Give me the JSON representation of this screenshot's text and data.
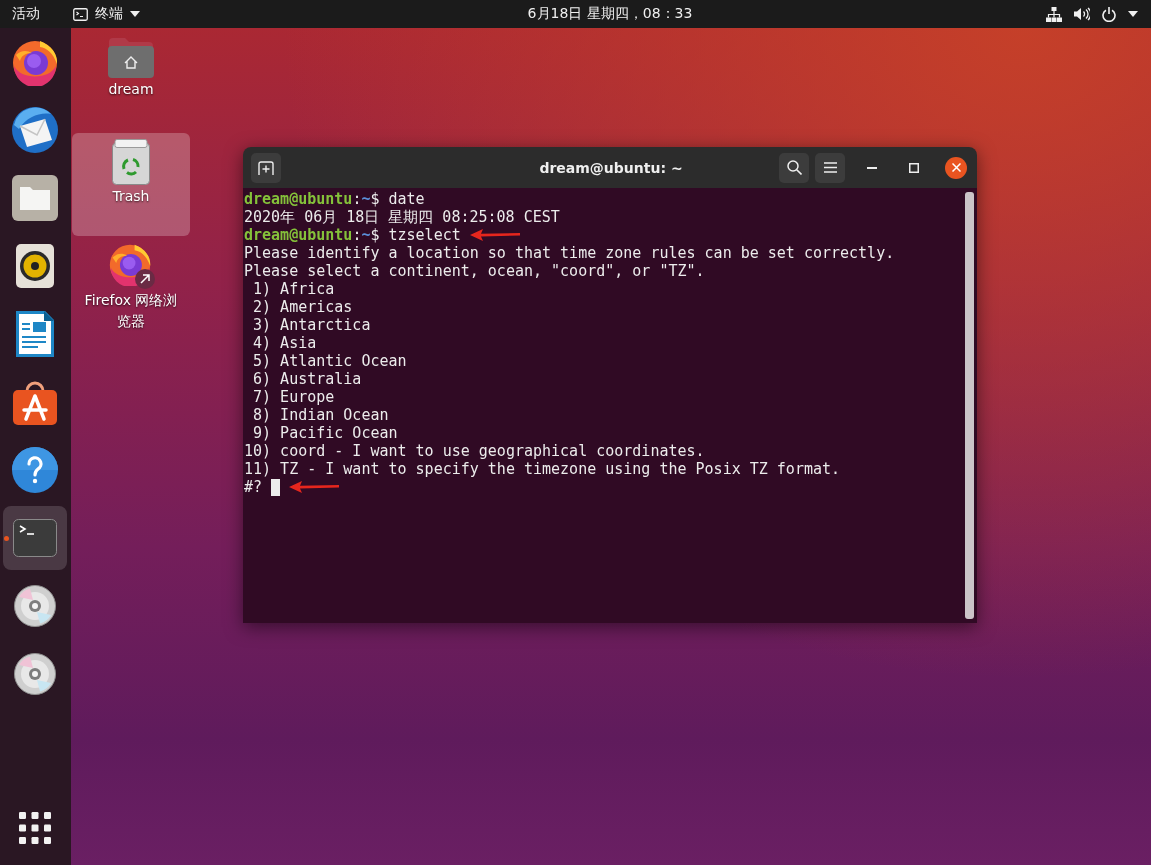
{
  "top_bar": {
    "activities": "活动",
    "app_menu": "终端",
    "clock": "6月18日 星期四，08：33"
  },
  "dock": {
    "items": [
      {
        "kind": "browser",
        "selected": false,
        "running": false
      },
      {
        "kind": "mail",
        "selected": false,
        "running": false
      },
      {
        "kind": "files",
        "selected": false,
        "running": false
      },
      {
        "kind": "music",
        "selected": false,
        "running": false
      },
      {
        "kind": "writer",
        "selected": false,
        "running": false
      },
      {
        "kind": "store",
        "selected": false,
        "running": false
      },
      {
        "kind": "help",
        "selected": false,
        "running": false
      },
      {
        "kind": "terminal",
        "selected": true,
        "running": true
      },
      {
        "kind": "disc",
        "selected": false,
        "running": false
      },
      {
        "kind": "disc",
        "selected": false,
        "running": false
      }
    ]
  },
  "desktop": {
    "icons": [
      {
        "kind": "home",
        "label": "dream",
        "selected": false
      },
      {
        "kind": "trash",
        "label": "Trash",
        "selected": true
      },
      {
        "kind": "shortcut",
        "label": "Firefox 网络浏览器",
        "selected": false
      }
    ]
  },
  "terminal": {
    "title": "dream@ubuntu: ~",
    "lines": [
      {
        "segments": [
          {
            "kind": "user",
            "text": "dream@ubuntu"
          },
          {
            "kind": "text",
            "text": ":"
          },
          {
            "kind": "path",
            "text": "~"
          },
          {
            "kind": "text",
            "text": "$ date"
          }
        ],
        "arrow": false,
        "cursor": false
      },
      {
        "segments": [
          {
            "kind": "text",
            "text": "2020年 06月 18日 星期四 08:25:08 CEST"
          }
        ],
        "arrow": false,
        "cursor": false
      },
      {
        "segments": [
          {
            "kind": "user",
            "text": "dream@ubuntu"
          },
          {
            "kind": "text",
            "text": ":"
          },
          {
            "kind": "path",
            "text": "~"
          },
          {
            "kind": "text",
            "text": "$ tzselect"
          }
        ],
        "arrow": true,
        "cursor": false
      },
      {
        "segments": [
          {
            "kind": "text",
            "text": "Please identify a location so that time zone rules can be set correctly."
          }
        ],
        "arrow": false,
        "cursor": false
      },
      {
        "segments": [
          {
            "kind": "text",
            "text": "Please select a continent, ocean, \"coord\", or \"TZ\"."
          }
        ],
        "arrow": false,
        "cursor": false
      },
      {
        "segments": [
          {
            "kind": "text",
            "text": " 1) Africa"
          }
        ],
        "arrow": false,
        "cursor": false
      },
      {
        "segments": [
          {
            "kind": "text",
            "text": " 2) Americas"
          }
        ],
        "arrow": false,
        "cursor": false
      },
      {
        "segments": [
          {
            "kind": "text",
            "text": " 3) Antarctica"
          }
        ],
        "arrow": false,
        "cursor": false
      },
      {
        "segments": [
          {
            "kind": "text",
            "text": " 4) Asia"
          }
        ],
        "arrow": false,
        "cursor": false
      },
      {
        "segments": [
          {
            "kind": "text",
            "text": " 5) Atlantic Ocean"
          }
        ],
        "arrow": false,
        "cursor": false
      },
      {
        "segments": [
          {
            "kind": "text",
            "text": " 6) Australia"
          }
        ],
        "arrow": false,
        "cursor": false
      },
      {
        "segments": [
          {
            "kind": "text",
            "text": " 7) Europe"
          }
        ],
        "arrow": false,
        "cursor": false
      },
      {
        "segments": [
          {
            "kind": "text",
            "text": " 8) Indian Ocean"
          }
        ],
        "arrow": false,
        "cursor": false
      },
      {
        "segments": [
          {
            "kind": "text",
            "text": " 9) Pacific Ocean"
          }
        ],
        "arrow": false,
        "cursor": false
      },
      {
        "segments": [
          {
            "kind": "text",
            "text": "10) coord - I want to use geographical coordinates."
          }
        ],
        "arrow": false,
        "cursor": false
      },
      {
        "segments": [
          {
            "kind": "text",
            "text": "11) TZ - I want to specify the timezone using the Posix TZ format."
          }
        ],
        "arrow": false,
        "cursor": false
      },
      {
        "segments": [
          {
            "kind": "text",
            "text": "#?"
          }
        ],
        "arrow": true,
        "cursor": true
      }
    ]
  }
}
